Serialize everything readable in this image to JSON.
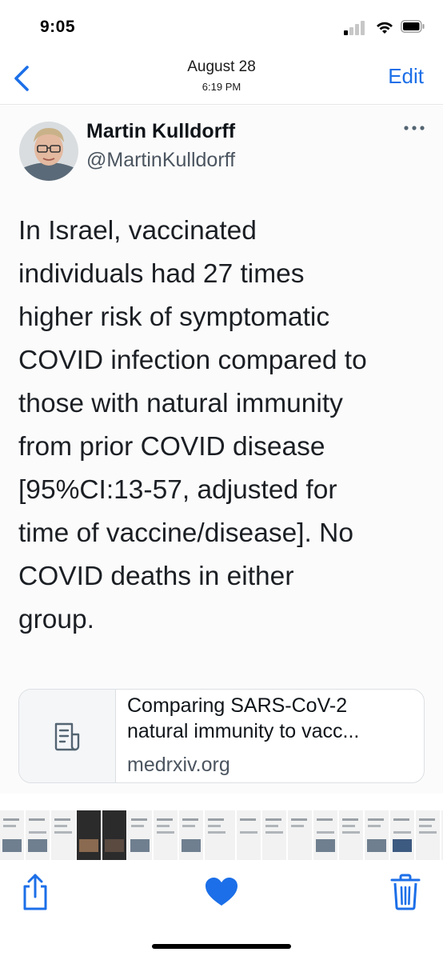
{
  "status_bar": {
    "time": "9:05"
  },
  "header": {
    "date": "August 28",
    "time": "6:19 PM",
    "edit_label": "Edit"
  },
  "tweet": {
    "author_name": "Martin Kulldorff",
    "author_handle": "@MartinKulldorff",
    "text": "In Israel, vaccinated\nindividuals had 27 times\nhigher risk of symptomatic\nCOVID infection compared to\nthose with natural immunity\nfrom prior COVID disease\n[95%CI:13-57, adjusted for\ntime of vaccine/disease]. No\nCOVID deaths in either\ngroup.",
    "link_card": {
      "title": "Comparing SARS-CoV-2\nnatural immunity to vacc...",
      "domain": "medrxiv.org"
    }
  },
  "colors": {
    "accent": "#1c6fe8",
    "text": "#1b1f24",
    "secondary": "#4b5560"
  },
  "icons": [
    "back-chevron-icon",
    "more-icon",
    "document-icon",
    "share-icon",
    "heart-icon",
    "trash-icon"
  ]
}
